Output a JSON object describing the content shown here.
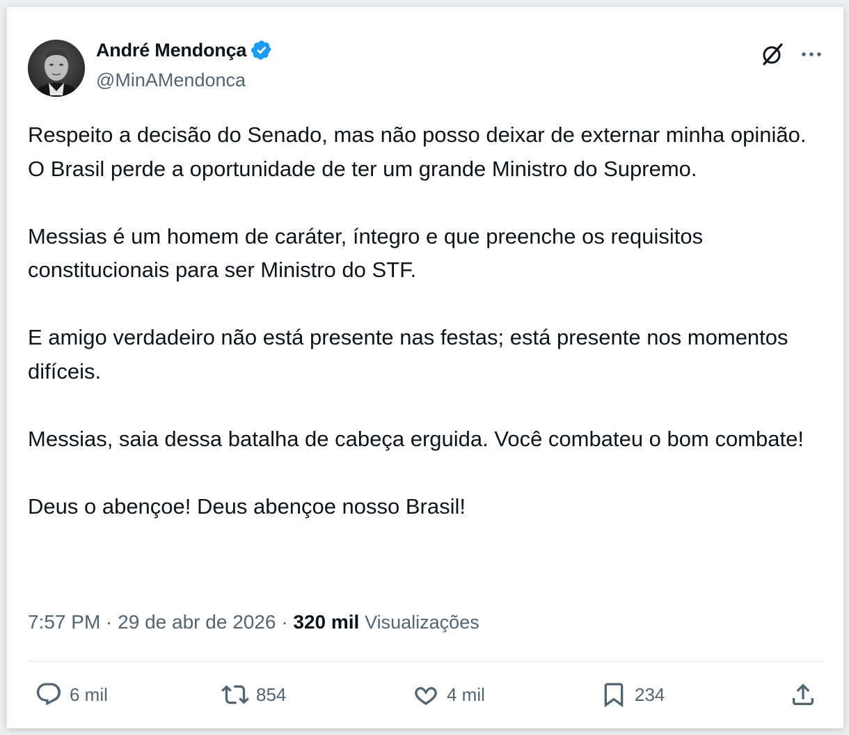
{
  "author": {
    "display_name": "André Mendonça",
    "handle": "@MinAMendonca",
    "verified": true
  },
  "tweet": {
    "paragraphs": [
      "Respeito a decisão do Senado, mas não posso deixar de externar minha opinião. O Brasil perde a oportunidade de ter um grande Ministro do Supremo.",
      "Messias é um homem de caráter, íntegro e que preenche os requisitos constitucionais para ser Ministro do STF.",
      "E amigo verdadeiro não está presente nas festas; está presente nos momentos difíceis.",
      "Messias, saia dessa batalha de cabeça erguida. Você combateu o bom combate!",
      "Deus o abençoe! Deus abençoe nosso Brasil!"
    ]
  },
  "meta": {
    "time": "7:57 PM",
    "separator": " · ",
    "date": "29 de abr de 2026",
    "views_count": "320 mil",
    "views_label": "Visualizações"
  },
  "actions": {
    "replies": "6 mil",
    "reposts": "854",
    "likes": "4 mil",
    "bookmarks": "234"
  },
  "icons": {
    "verified": "verified-badge-icon",
    "grok": "grok-icon",
    "more": "more-dots-icon",
    "reply": "reply-bubble-icon",
    "repost": "repost-arrows-icon",
    "like": "heart-icon",
    "bookmark": "bookmark-icon",
    "share": "share-upload-icon"
  },
  "colors": {
    "text_primary": "#0f1419",
    "text_secondary": "#536471",
    "verified_blue": "#1d9bf0",
    "divider": "#e4e8eb"
  }
}
